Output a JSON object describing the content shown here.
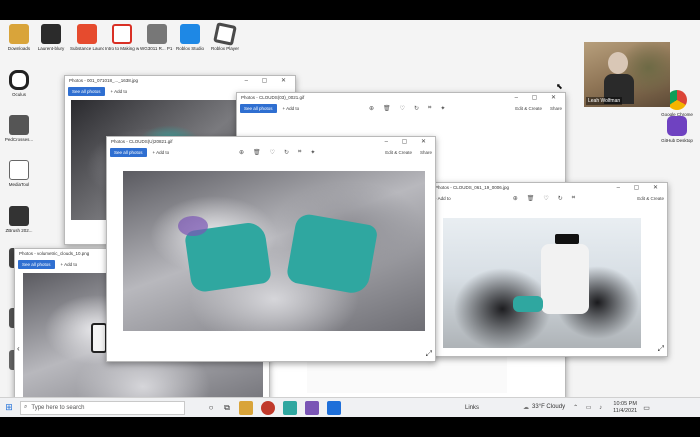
{
  "colors": {
    "accent": "#2f6fd1",
    "teal_gloves": "#2fa7a0",
    "taskbar": "#f0f1f3"
  },
  "desktop_icons_left": [
    {
      "label": "Downloads",
      "icon": "folder-icon",
      "color": "#d9a43a"
    },
    {
      "label": "Oculus",
      "icon": "oculus-icon",
      "color": "#222222"
    },
    {
      "label": "PedCrosses...",
      "icon": "document-icon",
      "color": "#555555"
    },
    {
      "label": "MediaTool",
      "icon": "document-icon",
      "color": "#666666"
    },
    {
      "label": "ZBrush 202...",
      "icon": "zbrush-icon",
      "color": "#333333"
    }
  ],
  "desktop_icons_top": [
    {
      "label": "Laurent-blury",
      "icon": "zbrush-icon",
      "color": "#2b2b2b"
    },
    {
      "label": "Substance Launcher",
      "icon": "substance-icon",
      "color": "#e64b2e"
    },
    {
      "label": "Intro to Making with...",
      "icon": "pdf-icon",
      "color": "#d93025"
    },
    {
      "label": "WG3011 R... P1 - D1571...",
      "icon": "video-file-icon",
      "color": "#777777"
    },
    {
      "label": "Roblox Studio",
      "icon": "roblox-studio-icon",
      "color": "#1e88e5"
    },
    {
      "label": "Roblox Player",
      "icon": "roblox-icon",
      "color": "#4a4a4a"
    }
  ],
  "desktop_icons_right": [
    {
      "label": "Google Chrome",
      "icon": "chrome-icon",
      "color": "#e5b21e"
    },
    {
      "label": "GitHub Desktop",
      "icon": "github-icon",
      "color": "#6f42c1"
    }
  ],
  "participant": {
    "name": "Leah Wolfman"
  },
  "windows": {
    "w1": {
      "title": "Photos - 001_071018_..._1638.jpg",
      "see_all": "See all photos",
      "add_to": "Add to"
    },
    "w2": {
      "title": "Photos - CLOUDS(03)_0021.gif",
      "see_all": "See all photos",
      "add_to": "Add to",
      "edit_create": "Edit & Create",
      "share": "Share"
    },
    "w3": {
      "title": "Photos - CLOUDS(U)20821.gif",
      "see_all": "See all photos",
      "add_to": "Add to",
      "edit_create": "Edit & Create",
      "share": "Share"
    },
    "w4": {
      "title": "Photos - CLOUDS_061_19_0006.jpg",
      "add_to": "Add to",
      "edit_create": "Edit & Create"
    },
    "w5": {
      "title": "Photos - volumetric_clouds_10.png",
      "see_all": "See all photos",
      "add_to": "Add to"
    }
  },
  "taskbar": {
    "search_placeholder": "Type here to search",
    "links_label": "Links",
    "weather": "33°F Cloudy",
    "time": "10:05 PM",
    "date": "11/4/2021"
  }
}
